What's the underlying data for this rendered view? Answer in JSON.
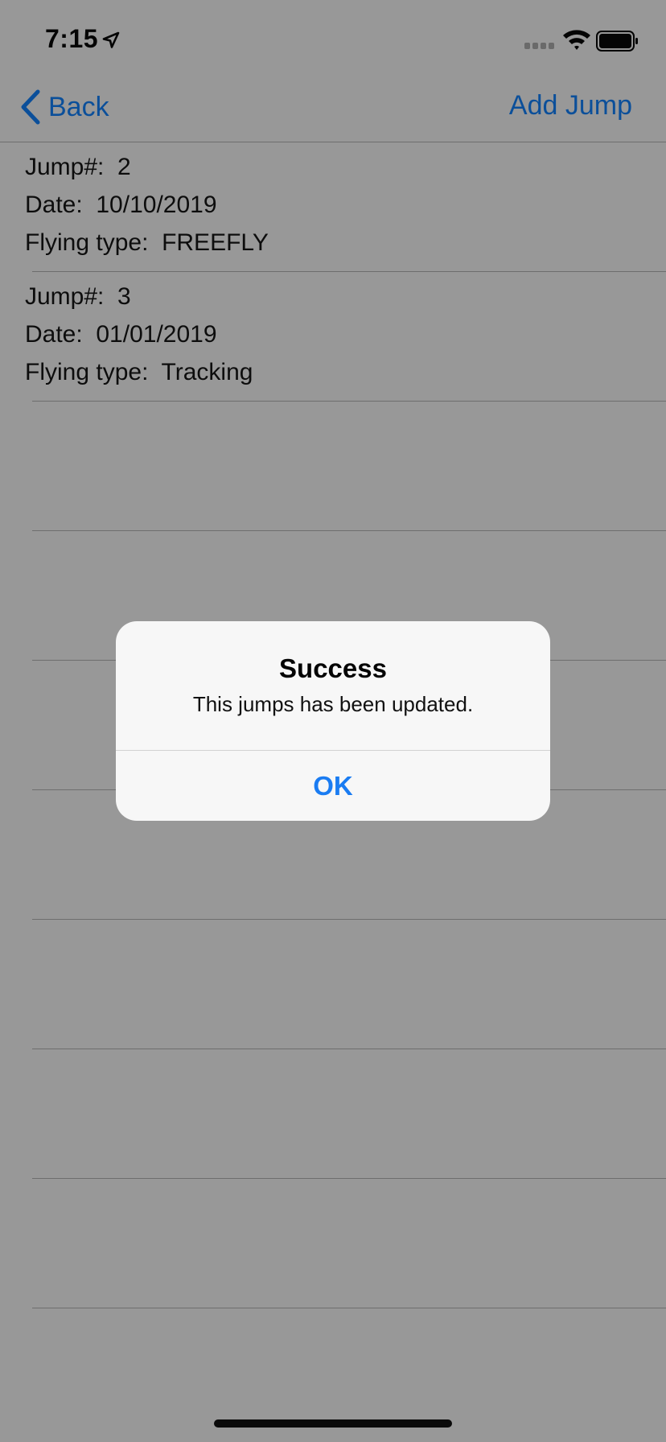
{
  "status_bar": {
    "time": "7:15",
    "icons": [
      "location-arrow-icon",
      "cellular-signal-icon",
      "wifi-icon",
      "battery-icon"
    ]
  },
  "nav": {
    "back_label": "Back",
    "add_label": "Add Jump",
    "accent_color": "#0b4f9a"
  },
  "jumps": [
    {
      "jump_line": "Jump#:  2",
      "date_line": "Date:  10/10/2019",
      "type_line": "Flying type:  FREEFLY"
    },
    {
      "jump_line": "Jump#:  3",
      "date_line": "Date:  01/01/2019",
      "type_line": "Flying type:  Tracking"
    },
    {
      "jump_line": "",
      "date_line": "",
      "type_line": ""
    },
    {
      "jump_line": "",
      "date_line": "",
      "type_line": ""
    },
    {
      "jump_line": "",
      "date_line": "",
      "type_line": ""
    },
    {
      "jump_line": "",
      "date_line": "",
      "type_line": ""
    },
    {
      "jump_line": "",
      "date_line": "",
      "type_line": ""
    },
    {
      "jump_line": "",
      "date_line": "",
      "type_line": ""
    },
    {
      "jump_line": "",
      "date_line": "",
      "type_line": ""
    }
  ],
  "alert": {
    "title": "Success",
    "message": "This jumps has been updated.",
    "ok_label": "OK",
    "ok_color": "#1a7cf2"
  }
}
